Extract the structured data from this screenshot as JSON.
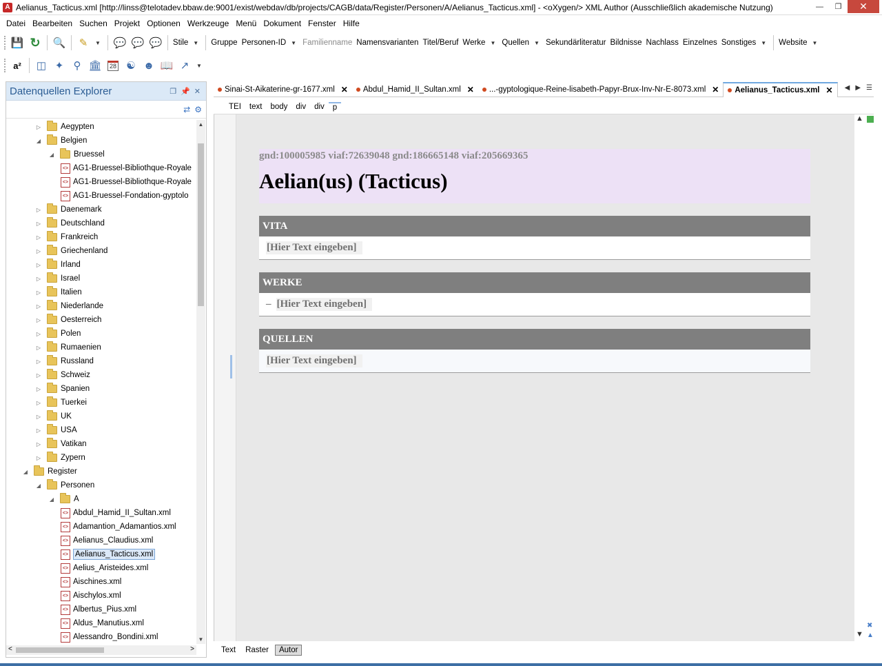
{
  "window": {
    "title": "Aelianus_Tacticus.xml [http://linss@telotadev.bbaw.de:9001/exist/webdav/db/projects/CAGB/data/Register/Personen/A/Aelianus_Tacticus.xml] - <oXygen/> XML Author (Ausschließlich akademische Nutzung)",
    "app_icon_letter": "A"
  },
  "menu": [
    "Datei",
    "Bearbeiten",
    "Suchen",
    "Projekt",
    "Optionen",
    "Werkzeuge",
    "Menü",
    "Dokument",
    "Fenster",
    "Hilfe"
  ],
  "toolbar1": {
    "stile": "Stile",
    "gruppe": "Gruppe",
    "personen_id": "Personen-ID",
    "familienname": "Familienname",
    "namensvarianten": "Namensvarianten",
    "titel_beruf": "Titel/Beruf",
    "werke": "Werke",
    "quellen": "Quellen",
    "sekundaerliteratur": "Sekundärliteratur",
    "bildnisse": "Bildnisse",
    "nachlass": "Nachlass",
    "einzelnes": "Einzelnes",
    "sonstiges": "Sonstiges",
    "website": "Website"
  },
  "toolbar2": {
    "superscript": "a²",
    "calendar_day": "28"
  },
  "explorer": {
    "title": "Datenquellen Explorer",
    "hscroll_arrow_left": "<",
    "hscroll_arrow_right": ">",
    "rows": [
      {
        "label": "Aegypten",
        "type": "folder",
        "depth": 2,
        "expanded": false
      },
      {
        "label": "Belgien",
        "type": "folder",
        "depth": 2,
        "expanded": true
      },
      {
        "label": "Bruessel",
        "type": "folder",
        "depth": 3,
        "expanded": true
      },
      {
        "label": "AG1-Bruessel-Bibliothque-Royale",
        "type": "file",
        "depth": 4
      },
      {
        "label": "AG1-Bruessel-Bibliothque-Royale",
        "type": "file",
        "depth": 4
      },
      {
        "label": "AG1-Bruessel-Fondation-gyptolo",
        "type": "file",
        "depth": 4
      },
      {
        "label": "Daenemark",
        "type": "folder",
        "depth": 2,
        "expanded": false
      },
      {
        "label": "Deutschland",
        "type": "folder",
        "depth": 2,
        "expanded": false
      },
      {
        "label": "Frankreich",
        "type": "folder",
        "depth": 2,
        "expanded": false
      },
      {
        "label": "Griechenland",
        "type": "folder",
        "depth": 2,
        "expanded": false
      },
      {
        "label": "Irland",
        "type": "folder",
        "depth": 2,
        "expanded": false
      },
      {
        "label": "Israel",
        "type": "folder",
        "depth": 2,
        "expanded": false
      },
      {
        "label": "Italien",
        "type": "folder",
        "depth": 2,
        "expanded": false
      },
      {
        "label": "Niederlande",
        "type": "folder",
        "depth": 2,
        "expanded": false
      },
      {
        "label": "Oesterreich",
        "type": "folder",
        "depth": 2,
        "expanded": false
      },
      {
        "label": "Polen",
        "type": "folder",
        "depth": 2,
        "expanded": false
      },
      {
        "label": "Rumaenien",
        "type": "folder",
        "depth": 2,
        "expanded": false
      },
      {
        "label": "Russland",
        "type": "folder",
        "depth": 2,
        "expanded": false
      },
      {
        "label": "Schweiz",
        "type": "folder",
        "depth": 2,
        "expanded": false
      },
      {
        "label": "Spanien",
        "type": "folder",
        "depth": 2,
        "expanded": false
      },
      {
        "label": "Tuerkei",
        "type": "folder",
        "depth": 2,
        "expanded": false
      },
      {
        "label": "UK",
        "type": "folder",
        "depth": 2,
        "expanded": false
      },
      {
        "label": "USA",
        "type": "folder",
        "depth": 2,
        "expanded": false
      },
      {
        "label": "Vatikan",
        "type": "folder",
        "depth": 2,
        "expanded": false
      },
      {
        "label": "Zypern",
        "type": "folder",
        "depth": 2,
        "expanded": false
      },
      {
        "label": "Register",
        "type": "folder",
        "depth": 1,
        "expanded": true
      },
      {
        "label": "Personen",
        "type": "folder",
        "depth": 2,
        "expanded": true
      },
      {
        "label": "A",
        "type": "folder",
        "depth": 3,
        "expanded": true
      },
      {
        "label": "Abdul_Hamid_II_Sultan.xml",
        "type": "file",
        "depth": 4
      },
      {
        "label": "Adamantion_Adamantios.xml",
        "type": "file",
        "depth": 4
      },
      {
        "label": "Aelianus_Claudius.xml",
        "type": "file",
        "depth": 4
      },
      {
        "label": "Aelianus_Tacticus.xml",
        "type": "file",
        "depth": 4,
        "selected": true
      },
      {
        "label": "Aelius_Aristeides.xml",
        "type": "file",
        "depth": 4
      },
      {
        "label": "Aischines.xml",
        "type": "file",
        "depth": 4
      },
      {
        "label": "Aischylos.xml",
        "type": "file",
        "depth": 4
      },
      {
        "label": "Albertus_Pius.xml",
        "type": "file",
        "depth": 4
      },
      {
        "label": "Aldus_Manutius.xml",
        "type": "file",
        "depth": 4
      },
      {
        "label": "Alessandro_Bondini.xml",
        "type": "file",
        "depth": 4
      }
    ]
  },
  "tabs": [
    {
      "label": "Sinai-St-Aikaterine-gr-1677.xml",
      "active": false
    },
    {
      "label": "Abdul_Hamid_II_Sultan.xml",
      "active": false
    },
    {
      "label": "...-gyptologique-Reine-lisabeth-Papyr-Brux-Inv-Nr-E-8073.xml",
      "active": false
    },
    {
      "label": "Aelianus_Tacticus.xml",
      "active": true
    }
  ],
  "breadcrumb": [
    "TEI",
    "text",
    "body",
    "div",
    "div",
    "p"
  ],
  "document": {
    "ids": "gnd:100005985 viaf:72639048 gnd:186665148 viaf:205669365",
    "name": "Aelian(us) (Tacticus)",
    "sections": [
      {
        "heading": "VITA",
        "placeholder": "[Hier Text eingeben]",
        "bullet": false
      },
      {
        "heading": "WERKE",
        "placeholder": "[Hier Text eingeben]",
        "bullet": true,
        "bullet_char": "–"
      },
      {
        "heading": "QUELLEN",
        "placeholder": "[Hier Text eingeben]",
        "bullet": false
      }
    ]
  },
  "modes": [
    {
      "label": "Text",
      "active": false
    },
    {
      "label": "Raster",
      "active": false
    },
    {
      "label": "Autor",
      "active": true
    }
  ],
  "colors": {
    "accent": "#3d6fa5",
    "section_header_bg": "#7f7f7f",
    "person_header_bg": "#ede1f6",
    "tab_dot": "#d04a20"
  }
}
